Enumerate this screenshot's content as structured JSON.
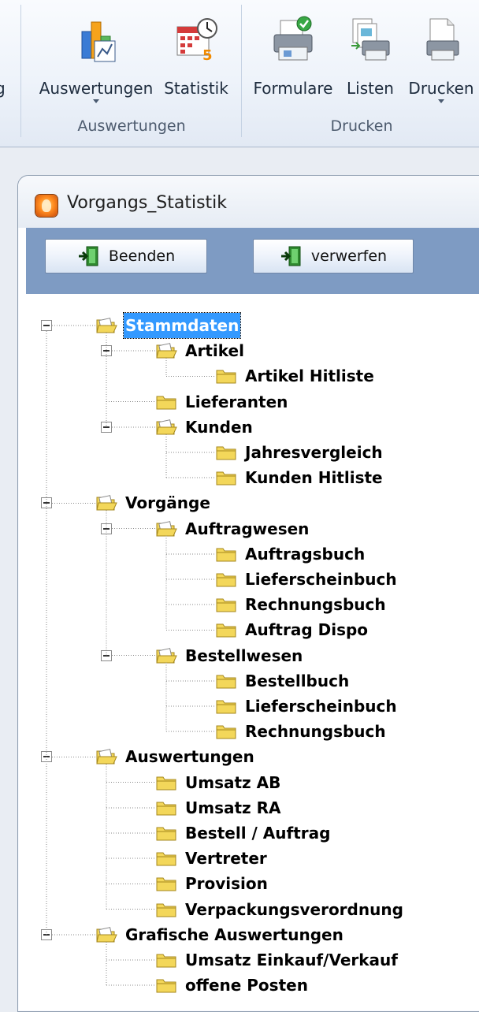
{
  "ribbon": {
    "stray_label": "g",
    "groups": [
      {
        "label": "Auswertungen",
        "buttons": [
          {
            "label": "Auswertungen",
            "icon": "bar-chart-icon",
            "has_dropdown": true
          },
          {
            "label": "Statistik",
            "icon": "calendar-clock-icon",
            "has_dropdown": false
          }
        ]
      },
      {
        "label": "Drucken",
        "buttons": [
          {
            "label": "Formulare",
            "icon": "printer-check-icon",
            "has_dropdown": false
          },
          {
            "label": "Listen",
            "icon": "documents-printer-icon",
            "has_dropdown": false
          },
          {
            "label": "Drucken",
            "icon": "document-printer-icon",
            "has_dropdown": true
          }
        ]
      }
    ]
  },
  "window": {
    "title": "Vorgangs_Statistik",
    "toolbar": {
      "beenden_label": "Beenden",
      "verwerfen_label": "verwerfen"
    }
  },
  "tree": [
    {
      "label": "Stammdaten",
      "open": true,
      "selected": true,
      "children": [
        {
          "label": "Artikel",
          "open": true,
          "children": [
            {
              "label": "Artikel Hitliste"
            }
          ]
        },
        {
          "label": "Lieferanten"
        },
        {
          "label": "Kunden",
          "open": true,
          "children": [
            {
              "label": "Jahresvergleich"
            },
            {
              "label": "Kunden Hitliste"
            }
          ]
        }
      ]
    },
    {
      "label": "Vorgänge",
      "open": true,
      "children": [
        {
          "label": "Auftragwesen",
          "open": true,
          "children": [
            {
              "label": "Auftragsbuch"
            },
            {
              "label": "Lieferscheinbuch"
            },
            {
              "label": "Rechnungsbuch"
            },
            {
              "label": "Auftrag Dispo"
            }
          ]
        },
        {
          "label": "Bestellwesen",
          "open": true,
          "children": [
            {
              "label": "Bestellbuch"
            },
            {
              "label": "Lieferscheinbuch"
            },
            {
              "label": "Rechnungsbuch"
            }
          ]
        }
      ]
    },
    {
      "label": "Auswertungen",
      "open": true,
      "children": [
        {
          "label": "Umsatz AB"
        },
        {
          "label": "Umsatz RA"
        },
        {
          "label": "Bestell / Auftrag"
        },
        {
          "label": "Vertreter"
        },
        {
          "label": "Provision"
        },
        {
          "label": "Verpackungsverordnung"
        }
      ]
    },
    {
      "label": "Grafische Auswertungen",
      "open": true,
      "children": [
        {
          "label": "Umsatz Einkauf/Verkauf"
        },
        {
          "label": "offene Posten"
        }
      ]
    }
  ],
  "colors": {
    "toolbar_bg": "#7e9bc3",
    "selection": "#3399ff",
    "folder_fill": "#f3d75a",
    "folder_edge": "#a4871c"
  }
}
